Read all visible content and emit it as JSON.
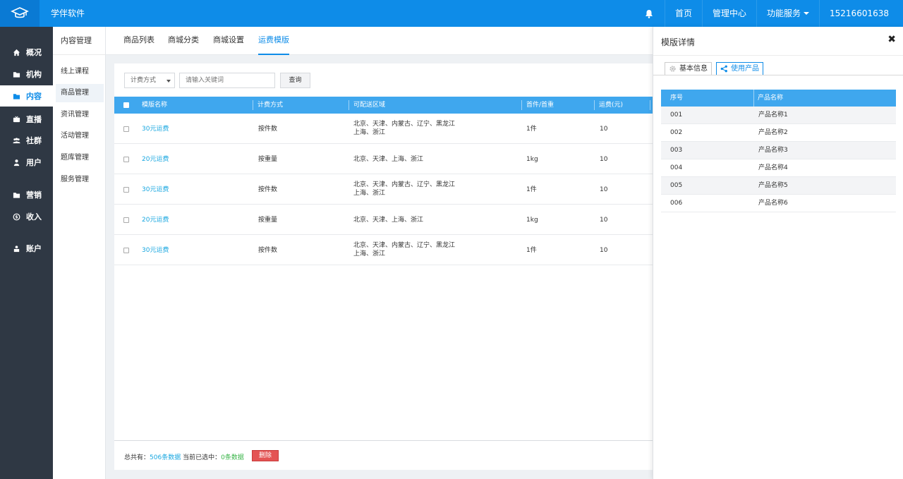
{
  "topbar": {
    "app_name": "学伴软件",
    "nav": [
      "首页",
      "管理中心",
      "功能服务"
    ],
    "phone": "15216601638",
    "icons": {
      "logo": "graduation-cap-icon",
      "bell": "bell-icon",
      "dropdown": "caret-down-icon"
    }
  },
  "sidebar": {
    "items": [
      {
        "label": "概况",
        "icon": "home-icon"
      },
      {
        "label": "机构",
        "icon": "folder-icon"
      },
      {
        "label": "内容",
        "icon": "folder-icon"
      },
      {
        "label": "直播",
        "icon": "broadcast-icon"
      },
      {
        "label": "社群",
        "icon": "group-icon"
      },
      {
        "label": "用户",
        "icon": "user-icon"
      },
      {
        "label": "营销",
        "icon": "folder-icon"
      },
      {
        "label": "收入",
        "icon": "coin-icon"
      },
      {
        "label": "账户",
        "icon": "account-icon"
      }
    ],
    "active_index": 2
  },
  "submenu": {
    "title": "内容管理",
    "items": [
      "线上课程",
      "商品管理",
      "资讯管理",
      "活动管理",
      "题库管理",
      "服务管理"
    ],
    "active_index": 1
  },
  "tabs": {
    "items": [
      "商品列表",
      "商城分类",
      "商城设置",
      "运费模版"
    ],
    "active_index": 3
  },
  "filters": {
    "select_value": "计费方式",
    "search_placeholder": "请输入关键词",
    "query_label": "查询"
  },
  "table": {
    "headers": [
      "模版名称",
      "计费方式",
      "可配送区域",
      "首件/首重",
      "运费(元)"
    ],
    "rows": [
      {
        "name": "30元运费",
        "method": "按件数",
        "region_line1": "北京、天津、内蒙古、辽宁、黑龙江",
        "region_line2": "上海、浙江",
        "first": "1件",
        "fee": "10"
      },
      {
        "name": "20元运费",
        "method": "按重量",
        "region_line1": "北京、天津、上海、浙江",
        "region_line2": "",
        "first": "1kg",
        "fee": "10"
      },
      {
        "name": "30元运费",
        "method": "按件数",
        "region_line1": "北京、天津、内蒙古、辽宁、黑龙江",
        "region_line2": "上海、浙江",
        "first": "1件",
        "fee": "10"
      },
      {
        "name": "20元运费",
        "method": "按重量",
        "region_line1": "北京、天津、上海、浙江",
        "region_line2": "",
        "first": "1kg",
        "fee": "10"
      },
      {
        "name": "30元运费",
        "method": "按件数",
        "region_line1": "北京、天津、内蒙古、辽宁、黑龙江",
        "region_line2": "上海、浙江",
        "first": "1件",
        "fee": "10"
      }
    ]
  },
  "footer": {
    "total_prefix": "总共有：",
    "total_count": "506条数据",
    "selected_prefix": "当前已选中：",
    "selected_count": "0条数据",
    "delete_label": "删除"
  },
  "drawer": {
    "title": "模版详情",
    "close_icon": "close-icon",
    "tabs": [
      {
        "label": "基本信息",
        "icon": "gear-icon"
      },
      {
        "label": "使用产品",
        "icon": "share-icon"
      }
    ],
    "active_tab": 1,
    "table_headers": [
      "序号",
      "产品名称"
    ],
    "rows": [
      {
        "id": "001",
        "name": "产品名称1"
      },
      {
        "id": "002",
        "name": "产品名称2"
      },
      {
        "id": "003",
        "name": "产品名称3"
      },
      {
        "id": "004",
        "name": "产品名称4"
      },
      {
        "id": "005",
        "name": "产品名称5"
      },
      {
        "id": "006",
        "name": "产品名称6"
      }
    ]
  },
  "colors": {
    "primary": "#0e8ce8",
    "sidebar": "#2f3844",
    "table_header": "#3fa7ee",
    "link": "#19a7e0",
    "danger": "#e45454",
    "success": "#3bb54a"
  }
}
